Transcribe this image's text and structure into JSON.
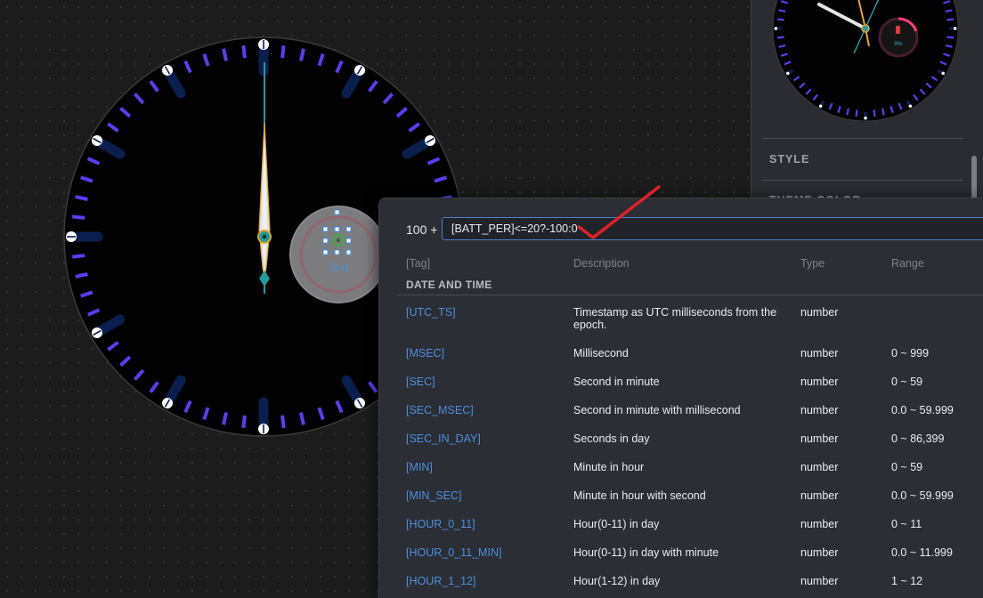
{
  "canvas": {
    "hand_placeholder_text": "Text"
  },
  "side_panel": {
    "preview_battery_text": "9%",
    "style_label": "STYLE",
    "theme_color_label": "THEME COLOR"
  },
  "expression_popup": {
    "prefix": "100 +",
    "expression_value": "[BATT_PER]<=20?-100:0",
    "columns": {
      "tag": "[Tag]",
      "description": "Description",
      "type": "Type",
      "range": "Range"
    },
    "section_title": "DATE AND TIME",
    "rows": [
      {
        "tag": "[UTC_TS]",
        "description": "Timestamp as UTC milliseconds from the epoch.",
        "type": "number",
        "range": ""
      },
      {
        "tag": "[MSEC]",
        "description": "Millisecond",
        "type": "number",
        "range": "0 ~ 999"
      },
      {
        "tag": "[SEC]",
        "description": "Second in minute",
        "type": "number",
        "range": "0 ~ 59"
      },
      {
        "tag": "[SEC_MSEC]",
        "description": "Second in minute with millisecond",
        "type": "number",
        "range": "0.0 ~ 59.999"
      },
      {
        "tag": "[SEC_IN_DAY]",
        "description": "Seconds in day",
        "type": "number",
        "range": "0 ~ 86,399"
      },
      {
        "tag": "[MIN]",
        "description": "Minute in hour",
        "type": "number",
        "range": "0 ~ 59"
      },
      {
        "tag": "[MIN_SEC]",
        "description": "Minute in hour with second",
        "type": "number",
        "range": "0.0 ~ 59.999"
      },
      {
        "tag": "[HOUR_0_11]",
        "description": "Hour(0-11) in day",
        "type": "number",
        "range": "0 ~ 11"
      },
      {
        "tag": "[HOUR_0_11_MIN]",
        "description": "Hour(0-11) in day with minute",
        "type": "number",
        "range": "0.0 ~ 11.999"
      },
      {
        "tag": "[HOUR_1_12]",
        "description": "Hour(1-12) in day",
        "type": "number",
        "range": "1 ~ 12"
      }
    ]
  },
  "colors": {
    "tick_accent": "#5b3cf0",
    "tag_link": "#4d8fe0",
    "input_border": "#4e7fd0",
    "hand_teal": "#1f9c9c",
    "annotation_check": "#e0212a"
  }
}
